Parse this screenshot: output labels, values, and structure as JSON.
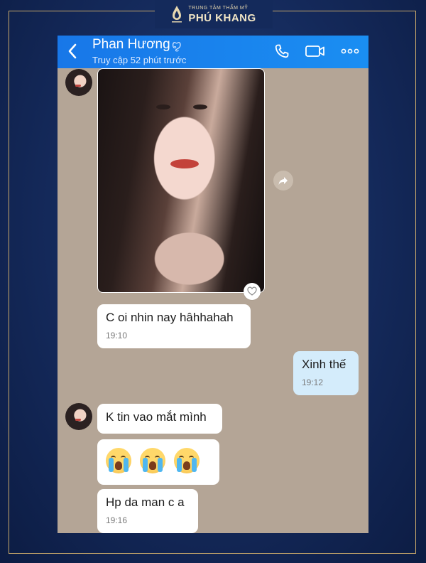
{
  "brand": {
    "small": "TRUNG TÂM THẨM MỸ",
    "name": "PHÚ KHANG"
  },
  "header": {
    "name": "Phan Hương",
    "name_mark": "ꨄ",
    "status": "Truy cập 52 phút trước",
    "icons": [
      "back-arrow-icon",
      "phone-icon",
      "video-icon",
      "more-icon"
    ],
    "bg_color": "#1a86ee"
  },
  "messages": [
    {
      "type": "image",
      "sender": "contact",
      "alt": "photo"
    },
    {
      "type": "text",
      "sender": "contact",
      "text": "C oi nhin nay hâhhahah",
      "time": "19:10"
    },
    {
      "type": "text",
      "sender": "me",
      "text": "Xinh thế",
      "time": "19:12"
    },
    {
      "type": "text",
      "sender": "contact",
      "text": "K tin vao mắt mình"
    },
    {
      "type": "emoji",
      "sender": "contact",
      "emojis": [
        "loudly-crying-face",
        "loudly-crying-face",
        "loudly-crying-face"
      ]
    },
    {
      "type": "text",
      "sender": "contact",
      "text": "Hp da man c a",
      "time": "19:16"
    }
  ],
  "colors": {
    "chat_bg": "#b4a596",
    "my_bubble": "#d4ecfb",
    "their_bubble": "#ffffff",
    "frame_bg": "#14295a",
    "frame_border": "#c8a86a"
  }
}
